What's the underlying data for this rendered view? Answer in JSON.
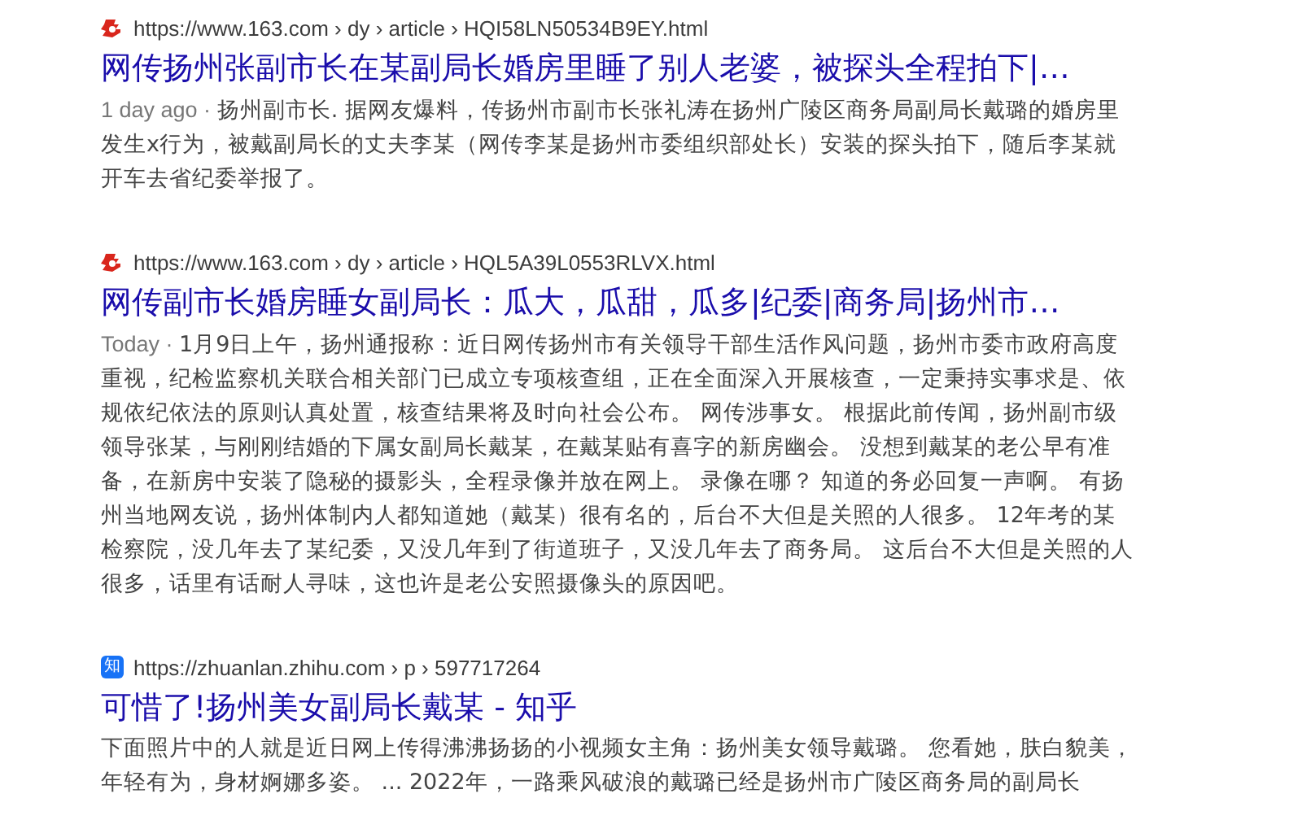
{
  "results": [
    {
      "favicon": {
        "kind": "netease"
      },
      "url": "https://www.163.com › dy › article › HQI58LN50534B9EY.html",
      "title": "网传扬州张副市长在某副局长婚房里睡了别人老婆，被探头全程拍下|…",
      "date": "1 day ago ·",
      "snippet": "扬州副市长. 据网友爆料，传扬州市副市长张礼涛在扬州广陵区商务局副局长戴璐的婚房里发生x行为，被戴副局长的丈夫李某（网传李某是扬州市委组织部处长）安装的探头拍下，随后李某就开车去省纪委举报了。"
    },
    {
      "favicon": {
        "kind": "netease"
      },
      "url": "https://www.163.com › dy › article › HQL5A39L0553RLVX.html",
      "title": "网传副市长婚房睡女副局长：瓜大，瓜甜，瓜多|纪委|商务局|扬州市…",
      "date": "Today ·",
      "snippet": "1月9日上午，扬州通报称：近日网传扬州市有关领导干部生活作风问题，扬州市委市政府高度重视，纪检监察机关联合相关部门已成立专项核查组，正在全面深入开展核查，一定秉持实事求是、依规依纪依法的原则认真处置，核查结果将及时向社会公布。 网传涉事女。 根据此前传闻，扬州副市级领导张某，与刚刚结婚的下属女副局长戴某，在戴某贴有喜字的新房幽会。 没想到戴某的老公早有准备，在新房中安装了隐秘的摄影头，全程录像并放在网上。 录像在哪？ 知道的务必回复一声啊。 有扬州当地网友说，扬州体制内人都知道她（戴某）很有名的，后台不大但是关照的人很多。 12年考的某检察院，没几年去了某纪委，又没几年到了街道班子，又没几年去了商务局。 这后台不大但是关照的人很多，话里有话耐人寻味，这也许是老公安照摄像头的原因吧。"
    },
    {
      "favicon": {
        "kind": "zhihu",
        "text": "知"
      },
      "url": "https://zhuanlan.zhihu.com › p › 597717264",
      "title": "可惜了!扬州美女副局长戴某 - 知乎",
      "snippet": "下面照片中的人就是近日网上传得沸沸扬扬的小视频女主角：扬州美女领导戴璐。 您看她，肤白貌美，年轻有为，身材婀娜多姿。 ... 2022年，一路乘风破浪的戴璐已经是扬州市广陵区商务局的副局长"
    }
  ]
}
